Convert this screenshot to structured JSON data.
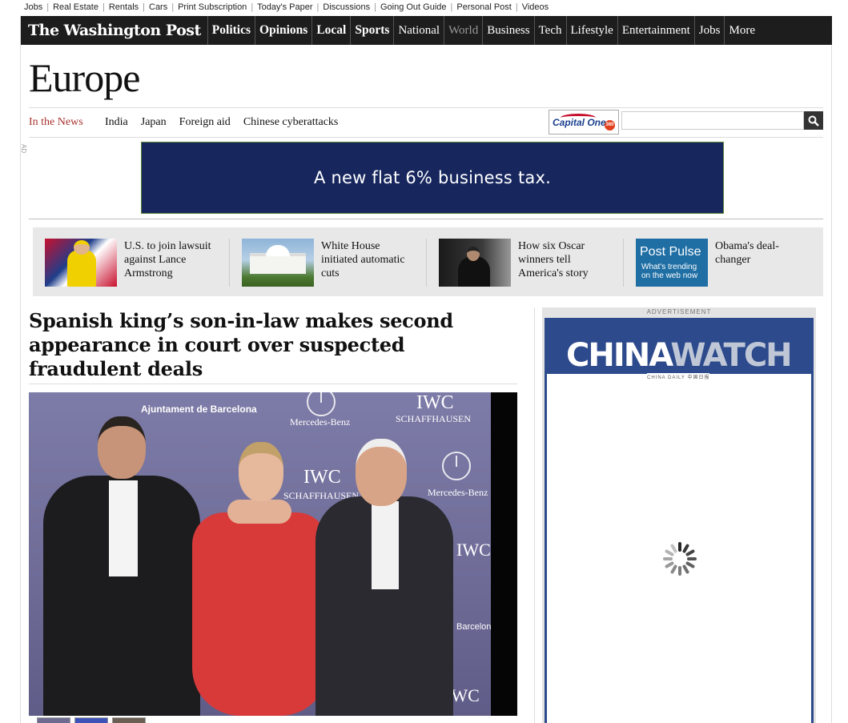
{
  "util_links": [
    "Jobs",
    "Real Estate",
    "Rentals",
    "Cars",
    "Print Subscription",
    "Today's Paper",
    "Discussions",
    "Going Out Guide",
    "Personal Post",
    "Videos"
  ],
  "nav": {
    "logo": "The Washington Post",
    "items": [
      {
        "label": "Politics",
        "bold": true
      },
      {
        "label": "Opinions",
        "bold": true
      },
      {
        "label": "Local",
        "bold": true
      },
      {
        "label": "Sports",
        "bold": true
      },
      {
        "label": "National",
        "bold": false
      },
      {
        "label": "World",
        "bold": false,
        "active": true
      },
      {
        "label": "Business",
        "bold": false
      },
      {
        "label": "Tech",
        "bold": false
      },
      {
        "label": "Lifestyle",
        "bold": false
      },
      {
        "label": "Entertainment",
        "bold": false
      },
      {
        "label": "Jobs",
        "bold": false
      },
      {
        "label": "More",
        "bold": false
      }
    ]
  },
  "section_title": "Europe",
  "in_the_news": {
    "label": "In the News",
    "topics": [
      "India",
      "Japan",
      "Foreign aid",
      "Chinese cyberattacks"
    ]
  },
  "sponsor": {
    "name": "Capital One",
    "badge": "360"
  },
  "ad": {
    "tag": "AD",
    "banner_text": "A new flat 6% business tax."
  },
  "promos": [
    {
      "caption": "U.S. to join lawsuit against Lance Armstrong",
      "thumb": "armstrong"
    },
    {
      "caption": "White House initiated automatic cuts",
      "thumb": "whitehouse"
    },
    {
      "caption": "How six Oscar winners tell America's story",
      "thumb": "oscar"
    },
    {
      "caption": "Obama's deal-changer",
      "thumb": "pulse",
      "thumb_title": "Post Pulse",
      "thumb_sub": "What's trending on the web now"
    }
  ],
  "article": {
    "headline": "Spanish king’s son-in-law makes second appearance in court over suspected fraudulent deals",
    "photo_labels": {
      "ajuntament": "Ajuntament de Barcelona",
      "mercedes": "Mercedes-Benz",
      "iwc": "IWC",
      "schaffhausen": "SCHAFFHAUSEN",
      "barcelona": "Barcelona"
    }
  },
  "right_ad": {
    "label": "ADVERTISEMENT",
    "brand_a": "CHINA",
    "brand_b": "WATCH",
    "sub": "CHINA DAILY 中国日报"
  },
  "colors": {
    "nav_bg": "#1d1d1d",
    "news_label": "#a8322f",
    "banner_bg": "#17275e",
    "pulse": "#1f6ea4",
    "china_blue": "#2c4a8c"
  }
}
